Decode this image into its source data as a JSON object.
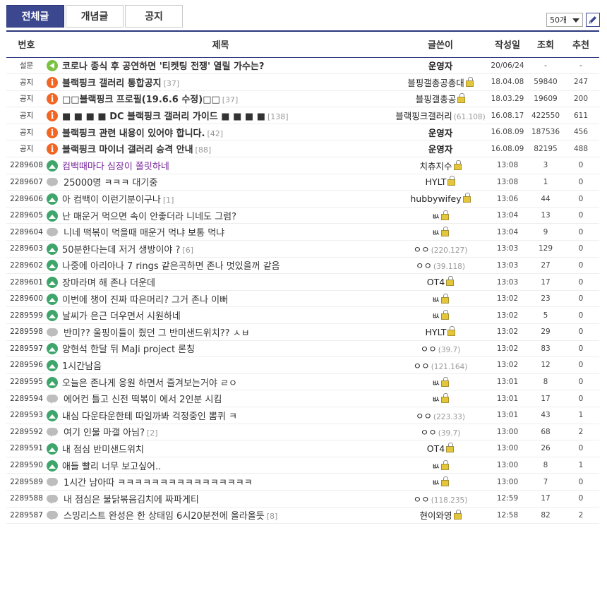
{
  "tabs": [
    {
      "label": "전체글",
      "active": true
    },
    {
      "label": "개념글",
      "active": false
    },
    {
      "label": "공지",
      "active": false
    }
  ],
  "list_count": "50개",
  "headers": {
    "no": "번호",
    "subject": "제목",
    "writer": "글쓴이",
    "date": "작성일",
    "views": "조회",
    "rec": "추천"
  },
  "rows": [
    {
      "no": "설문",
      "icon": "speaker-icon",
      "subject": "코로나 종식 후 공연하면 '티켓팅 전쟁' 열릴 가수는?",
      "reply": "",
      "writer": "운영자",
      "ip": "",
      "lock": false,
      "date": "20/06/24",
      "views": "-",
      "rec": "-",
      "notice": true
    },
    {
      "no": "공지",
      "icon": "info-icon",
      "subject": "블랙핑크 갤러리 통합공지",
      "reply": "[37]",
      "writer": "블핑갤총공총대",
      "ip": "",
      "lock": true,
      "date": "18.04.08",
      "views": "59840",
      "rec": "247",
      "notice": true
    },
    {
      "no": "공지",
      "icon": "info-icon",
      "subject": "□□블랙핑크 프로필(19.6.6 수정)□□",
      "reply": "[37]",
      "writer": "블핑갤총공",
      "ip": "",
      "lock": true,
      "date": "18.03.29",
      "views": "19609",
      "rec": "200",
      "notice": true
    },
    {
      "no": "공지",
      "icon": "info-icon",
      "subject": "■ ■ ■ ■ DC 블랙핑크 갤러리 가이드 ■ ■ ■ ■",
      "reply": "[138]",
      "writer": "블랙핑크갤러리",
      "ip": "(61.108)",
      "lock": false,
      "date": "16.08.17",
      "views": "422550",
      "rec": "611",
      "notice": true
    },
    {
      "no": "공지",
      "icon": "info-icon",
      "subject": "블랙핑크 관련 내용이 있어야 합니다.",
      "reply": "[42]",
      "writer": "운영자",
      "ip": "",
      "lock": false,
      "date": "16.08.09",
      "views": "187536",
      "rec": "456",
      "notice": true
    },
    {
      "no": "공지",
      "icon": "info-icon",
      "subject": "블랙핑크 마이너 갤러리 승격 안내",
      "reply": "[88]",
      "writer": "운영자",
      "ip": "",
      "lock": false,
      "date": "16.08.09",
      "views": "82195",
      "rec": "488",
      "notice": true
    },
    {
      "no": "2289608",
      "icon": "image-icon",
      "subject": "컴백때마다 심장이 쫄릿하네",
      "reply": "",
      "writer": "치츄지수",
      "ip": "",
      "lock": true,
      "date": "13:08",
      "views": "3",
      "rec": "0",
      "visited": true
    },
    {
      "no": "2289607",
      "icon": "text-icon",
      "subject": "25000명 ㅋㅋㅋ 대기중",
      "reply": "",
      "writer": "HYLT",
      "ip": "",
      "lock": true,
      "date": "13:08",
      "views": "1",
      "rec": "0"
    },
    {
      "no": "2289606",
      "icon": "image-icon",
      "subject": "아 컴백이 이런기분이구나",
      "reply": "[1]",
      "writer": "hubbywifey",
      "ip": "",
      "lock": true,
      "date": "13:06",
      "views": "44",
      "rec": "0"
    },
    {
      "no": "2289605",
      "icon": "image-icon",
      "subject": "난 매운거 먹으면 속이 안좋더라 니네도 그럼?",
      "reply": "",
      "writer": "ㅄ",
      "ip": "",
      "lock": true,
      "date": "13:04",
      "views": "13",
      "rec": "0"
    },
    {
      "no": "2289604",
      "icon": "text-icon",
      "subject": "니네 떡볶이 먹을때 매운거 먹냐 보통 먹냐",
      "reply": "",
      "writer": "ㅄ",
      "ip": "",
      "lock": true,
      "date": "13:04",
      "views": "9",
      "rec": "0"
    },
    {
      "no": "2289603",
      "icon": "image-icon",
      "subject": "50분한다는데 저거 생방이야 ?",
      "reply": "[6]",
      "writer": "ㅇㅇ",
      "ip": "(220.127)",
      "lock": false,
      "date": "13:03",
      "views": "129",
      "rec": "0"
    },
    {
      "no": "2289602",
      "icon": "image-icon",
      "subject": "나중에 아리아나 7 rings 같은곡하면 존나 멋있을꺼 같음",
      "reply": "",
      "writer": "ㅇㅇ",
      "ip": "(39.118)",
      "lock": false,
      "date": "13:03",
      "views": "27",
      "rec": "0"
    },
    {
      "no": "2289601",
      "icon": "image-icon",
      "subject": "장마라며 해 존나 더운데",
      "reply": "",
      "writer": "OT4",
      "ip": "",
      "lock": true,
      "date": "13:03",
      "views": "17",
      "rec": "0"
    },
    {
      "no": "2289600",
      "icon": "image-icon",
      "subject": "이번에 챙이 진짜 따은머리? 그거 존나 이뻐",
      "reply": "",
      "writer": "ㅄ",
      "ip": "",
      "lock": true,
      "date": "13:02",
      "views": "23",
      "rec": "0"
    },
    {
      "no": "2289599",
      "icon": "image-icon",
      "subject": "날씨가 은근 더우면서 시원하네",
      "reply": "",
      "writer": "ㅄ",
      "ip": "",
      "lock": true,
      "date": "13:02",
      "views": "5",
      "rec": "0"
    },
    {
      "no": "2289598",
      "icon": "text-icon",
      "subject": "반미?? 울핑이들이 줬던 그 반미샌드위치?? ㅅㅂ",
      "reply": "",
      "writer": "HYLT",
      "ip": "",
      "lock": true,
      "date": "13:02",
      "views": "29",
      "rec": "0"
    },
    {
      "no": "2289597",
      "icon": "image-icon",
      "subject": "양현석 한달 뒤 MaJi project 론칭",
      "reply": "",
      "writer": "ㅇㅇ",
      "ip": "(39.7)",
      "lock": false,
      "date": "13:02",
      "views": "83",
      "rec": "0"
    },
    {
      "no": "2289596",
      "icon": "image-icon",
      "subject": "1시간남음",
      "reply": "",
      "writer": "ㅇㅇ",
      "ip": "(121.164)",
      "lock": false,
      "date": "13:02",
      "views": "12",
      "rec": "0"
    },
    {
      "no": "2289595",
      "icon": "image-icon",
      "subject": "오늘은 존나게 응원 하면서 즐겨보는거야 ㄹㅇ",
      "reply": "",
      "writer": "ㅄ",
      "ip": "",
      "lock": true,
      "date": "13:01",
      "views": "8",
      "rec": "0"
    },
    {
      "no": "2289594",
      "icon": "text-icon",
      "subject": "에어컨 틀고 신전 떡볶이 에서 2인분 시킴",
      "reply": "",
      "writer": "ㅄ",
      "ip": "",
      "lock": true,
      "date": "13:01",
      "views": "17",
      "rec": "0"
    },
    {
      "no": "2289593",
      "icon": "image-icon",
      "subject": "내심 다운타운한테 따일까봐 걱정중인 뽐퀴 ㅋ",
      "reply": "",
      "writer": "ㅇㅇ",
      "ip": "(223.33)",
      "lock": false,
      "date": "13:01",
      "views": "43",
      "rec": "1"
    },
    {
      "no": "2289592",
      "icon": "text-icon",
      "subject": "여기 인물 마갤 아님?",
      "reply": "[2]",
      "writer": "ㅇㅇ",
      "ip": "(39.7)",
      "lock": false,
      "date": "13:00",
      "views": "68",
      "rec": "2"
    },
    {
      "no": "2289591",
      "icon": "image-icon",
      "subject": "내 점심 반미샌드위치",
      "reply": "",
      "writer": "OT4",
      "ip": "",
      "lock": true,
      "date": "13:00",
      "views": "26",
      "rec": "0"
    },
    {
      "no": "2289590",
      "icon": "image-icon",
      "subject": "애들 빨리 너무 보고싶어..",
      "reply": "",
      "writer": "ㅄ",
      "ip": "",
      "lock": true,
      "date": "13:00",
      "views": "8",
      "rec": "1"
    },
    {
      "no": "2289589",
      "icon": "text-icon",
      "subject": "1시간 남아따 ㅋㅋㅋㅋㅋㅋㅋㅋㅋㅋㅋㅋㅋㅋㅋㅋ",
      "reply": "",
      "writer": "ㅄ",
      "ip": "",
      "lock": true,
      "date": "13:00",
      "views": "7",
      "rec": "0"
    },
    {
      "no": "2289588",
      "icon": "text-icon",
      "subject": "내 점심은 불닭볶음김치에 짜파게티",
      "reply": "",
      "writer": "ㅇㅇ",
      "ip": "(118.235)",
      "lock": false,
      "date": "12:59",
      "views": "17",
      "rec": "0"
    },
    {
      "no": "2289587",
      "icon": "text-icon",
      "subject": "스밍리스트 완성은 한 상태임 6시20분전에 올라올듯",
      "reply": "[8]",
      "writer": "현이와영",
      "ip": "",
      "lock": true,
      "date": "12:58",
      "views": "82",
      "rec": "2"
    }
  ]
}
